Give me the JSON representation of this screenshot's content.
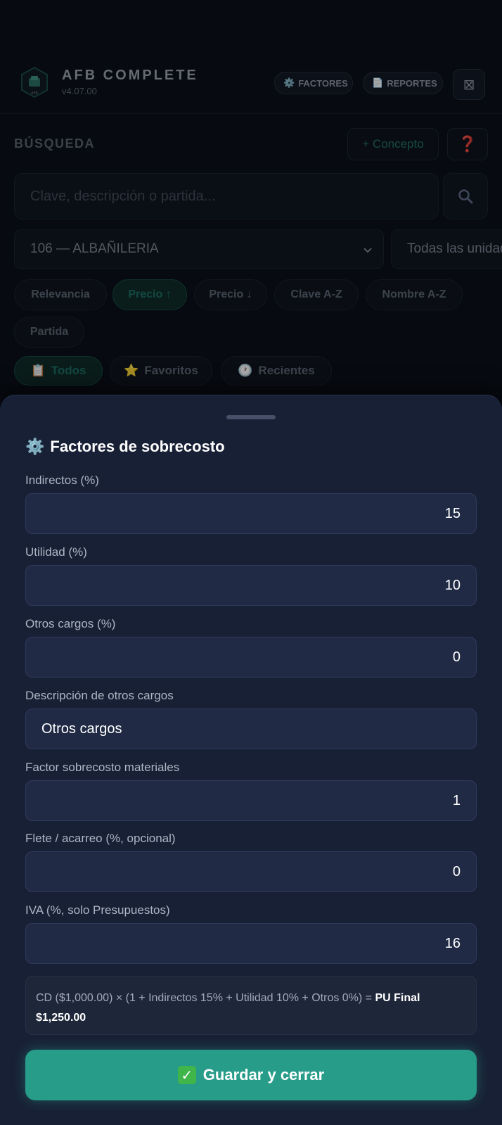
{
  "header": {
    "app_title": "AFB COMPLETE",
    "version": "v4.07.00",
    "logo_text": "AFB",
    "factores_label": "FACTORES",
    "reportes_label": "REPORTES",
    "close_icon": "close-icon"
  },
  "search": {
    "section_title": "BÚSQUEDA",
    "add_concept_label": "+ Concepto",
    "help_label": "❓",
    "placeholder": "Clave, descripción o partida...",
    "category_select": "106 — ALBAÑILERIA",
    "units_select": "Todas las unidades"
  },
  "sort_chips": [
    {
      "label": "Relevancia",
      "active": false
    },
    {
      "label": "Precio ↑",
      "active": true
    },
    {
      "label": "Precio ↓",
      "active": false
    },
    {
      "label": "Clave A-Z",
      "active": false
    },
    {
      "label": "Nombre A-Z",
      "active": false
    },
    {
      "label": "Partida",
      "active": false
    }
  ],
  "tabs": [
    {
      "label": "Todos",
      "icon": "📋",
      "active": true
    },
    {
      "label": "Favoritos",
      "icon": "⭐",
      "active": false
    },
    {
      "label": "Recientes",
      "icon": "🕐",
      "active": false
    }
  ],
  "sheet": {
    "title": "Factores de sobrecosto",
    "title_icon": "⚙️",
    "fields": [
      {
        "label": "Indirectos (%)",
        "value": "15"
      },
      {
        "label": "Utilidad (%)",
        "value": "10"
      },
      {
        "label": "Otros cargos (%)",
        "value": "0"
      },
      {
        "label": "Descripción de otros cargos",
        "value": "Otros cargos"
      },
      {
        "label": "Factor sobrecosto materiales",
        "value": "1"
      },
      {
        "label": "Flete / acarreo (%, opcional)",
        "value": "0"
      },
      {
        "label": "IVA (%, solo Presupuestos)",
        "value": "16"
      }
    ],
    "summary_text": "CD ($1,000.00) × (1 + Indirectos 15% + Utilidad 10% + Otros 0%) = ",
    "summary_bold": "PU Final $1,250.00",
    "save_label": "Guardar y cerrar"
  },
  "colors": {
    "accent": "#279c89",
    "sheet_bg": "#182035",
    "input_bg": "#212a45"
  }
}
